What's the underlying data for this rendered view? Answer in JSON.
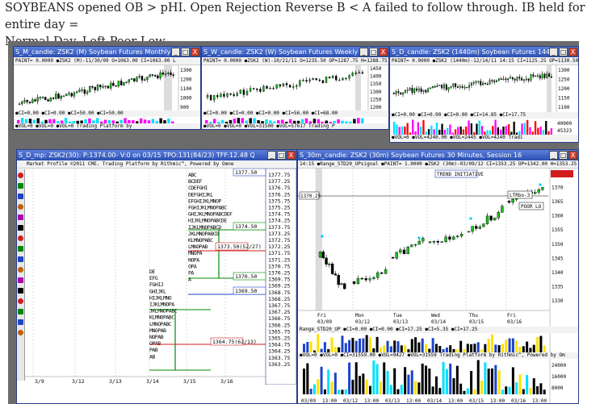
{
  "caption": {
    "line1": "SOYBEANS opened OB > pHI. Open Rejection Reverse B < A failed to follow through. IB held for entire day =",
    "line2": "Normal Day. Left Poor Low."
  },
  "window_buttons": {
    "minimize": "_",
    "maximize": "□",
    "close": "X"
  },
  "windows": {
    "monthly": {
      "title": "S_M_candle: ZSK2 (M) Soybean Futures Monthly",
      "info": "PAINT= 0.0000 ●ZSK2 (M)-11/30/09 O=1063.00 CI=1063.00 L",
      "axis": [
        "1300",
        "1200",
        "1100",
        "1000",
        "900"
      ],
      "osc": "●CI=0.00 ●CI=0.00 ●CI=50.00 ●CI=50.00",
      "vol": "●VOL=0 ●VOL=0 ●VOL=0 Trading Platform by"
    },
    "weekly": {
      "title": "S_W_candle: ZSK2 (W) Soybean Futures Weekly",
      "info": "PAINT= 0.0000 ●ZSK2 (W)-10/21/11 O=1235.50 OP=1287.75 H=1288.75 L",
      "axis": [
        "1450",
        "1400",
        "1350",
        "1300",
        "1250",
        "1200"
      ],
      "osc": "●CI=0.00 ●CI=0.00 ●CI=0.00 ●CI=56.00 ●CI=68.00",
      "vol": "●VOL=0 ●VOL=0 ●VOL=31500 ●VOL=57617 Trading P"
    },
    "daily": {
      "title": "S_D_candle: ZSK2 (1440m) Soybean Futures 144...",
      "info": "PAINT= 0.0000 ●ZSK2 (1440m)-12/14/11 14:15 CI=1125.25 OP=1130.50 L",
      "axis": [
        "1300",
        "1250",
        "1200",
        "1150",
        "1100"
      ],
      "osc": "●CI=0.00 ●CI=0.00 ●CI=0.00 ●CI=14.85 ●CI=17.75",
      "vol": "●VOL=0 ●VOL=4240.00 ●VOL=2445 ●VOL=4240 Tradi",
      "vol_axis": [
        "40000",
        "45323"
      ]
    },
    "mp": {
      "title": "S_D_mp: ZSK2(30): P:1374.00- V:0 on 03/15 TPO:131(84/23) TFF:12.48 Q%:50.00",
      "header": "Market Profile ©2011 CME. Trading Platform by Rithmic™, Powered by Omne",
      "prices": [
        "1377.75",
        "1377.25",
        "1376.75",
        "1376.25",
        "1375.75",
        "1375.25",
        "1374.75",
        "1374.25",
        "1373.75",
        "1373.25",
        "1372.75",
        "1372.25",
        "1371.75",
        "1371.25",
        "1370.75",
        "1370.25",
        "1369.75",
        "1369.25",
        "1368.75",
        "1368.25",
        "1367.75",
        "1367.25",
        "1366.75",
        "1366.25",
        "1365.75",
        "1365.25",
        "1364.75",
        "1364.25",
        "1363.75",
        "1363.25"
      ],
      "boxes": [
        "1377.50",
        "1374.50",
        "1373.50(52/27)",
        "1370.50",
        "1369.50",
        "1364.75(62/13)",
        "ZSK2"
      ],
      "dates": [
        "3/9",
        "3/12",
        "3/13",
        "3/14",
        "3/15",
        "3/16"
      ]
    },
    "thirty": {
      "title": "S_30m_candle: ZSK2 (30m) Soybean Futures 30 Minutes, Session 16",
      "info": "14:15 ●Range_STD20_UPsignal ●PAINT= 1.0000 ●ZSK2 (30m)-03/09/12 CI=1353.25 OP=1342.00 H=1353.25 L",
      "axis": [
        "1375.25",
        "1370",
        "1365",
        "1360",
        "1355",
        "1350",
        "1345",
        "1340",
        "1335",
        "1330"
      ],
      "labels": {
        "trend": "TREND INITIATIVE",
        "ltr": "LTRbo-3",
        "poor": "POOR LO",
        "level": "1370.25"
      },
      "dates": [
        {
          "day": "Fri",
          "date": "03/09"
        },
        {
          "day": "Mon",
          "date": "03/12"
        },
        {
          "day": "Tue",
          "date": "03/13"
        },
        {
          "day": "Wed",
          "date": "03/14"
        },
        {
          "day": "Thu",
          "date": "03/15"
        },
        {
          "day": "Fri",
          "date": "03/16"
        }
      ],
      "osc": "Range_STD20_UP ●CI=0.00 ●CI=0.00 ●CI=17.25 ●CI=5.35 ●CI=17.25",
      "vol": "●VOL=0 ●VOL=0 ●CI=31559.00 ●VOL=9427 ●VOL=31559 Trading Platform by Rithmic™, Powered by Om",
      "vol_axis": [
        "24000",
        "16000",
        "8000"
      ],
      "time_axis": [
        "03/09",
        "13:00",
        "03/12",
        "13:00",
        "03/13",
        "13:00",
        "03/14",
        "13:00",
        "03/15",
        "13:00",
        "03/16",
        "13:00"
      ]
    }
  }
}
